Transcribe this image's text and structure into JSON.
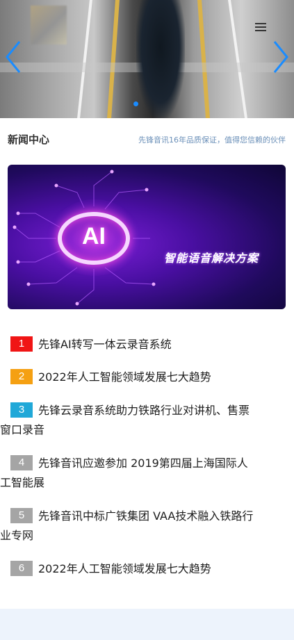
{
  "carousel": {
    "prev_icon": "chevron-left-icon",
    "next_icon": "chevron-right-icon",
    "menu_icon": "menu-icon",
    "active_slide": 1,
    "slide_count": 1,
    "accent_color": "#1a8cff"
  },
  "news_section": {
    "title": "新闻中心",
    "subtitle": "先锋音讯16年品质保证，值得您信赖的伙伴"
  },
  "banner": {
    "logo_text": "AI",
    "slogan": "智能语音解决方案"
  },
  "news_list": [
    {
      "rank": "1",
      "line1": "先锋AI转写一体云录音系统",
      "line2": "",
      "color": "#f01515"
    },
    {
      "rank": "2",
      "line1": "2022年人工智能领域发展七大趋势",
      "line2": "",
      "color": "#f5a012"
    },
    {
      "rank": "3",
      "line1": "先锋云录音系统助力铁路行业对讲机、售票",
      "line2": "窗口录音",
      "color": "#20a8d8"
    },
    {
      "rank": "4",
      "line1": "先锋音讯应邀参加 2019第四届上海国际人",
      "line2": "工智能展",
      "color": "#a5a5a5"
    },
    {
      "rank": "5",
      "line1": "先锋音讯中标广铁集团 VAA技术融入铁路行",
      "line2": "业专网",
      "color": "#a5a5a5"
    },
    {
      "rank": "6",
      "line1": "2022年人工智能领域发展七大趋势",
      "line2": "",
      "color": "#a5a5a5"
    }
  ]
}
